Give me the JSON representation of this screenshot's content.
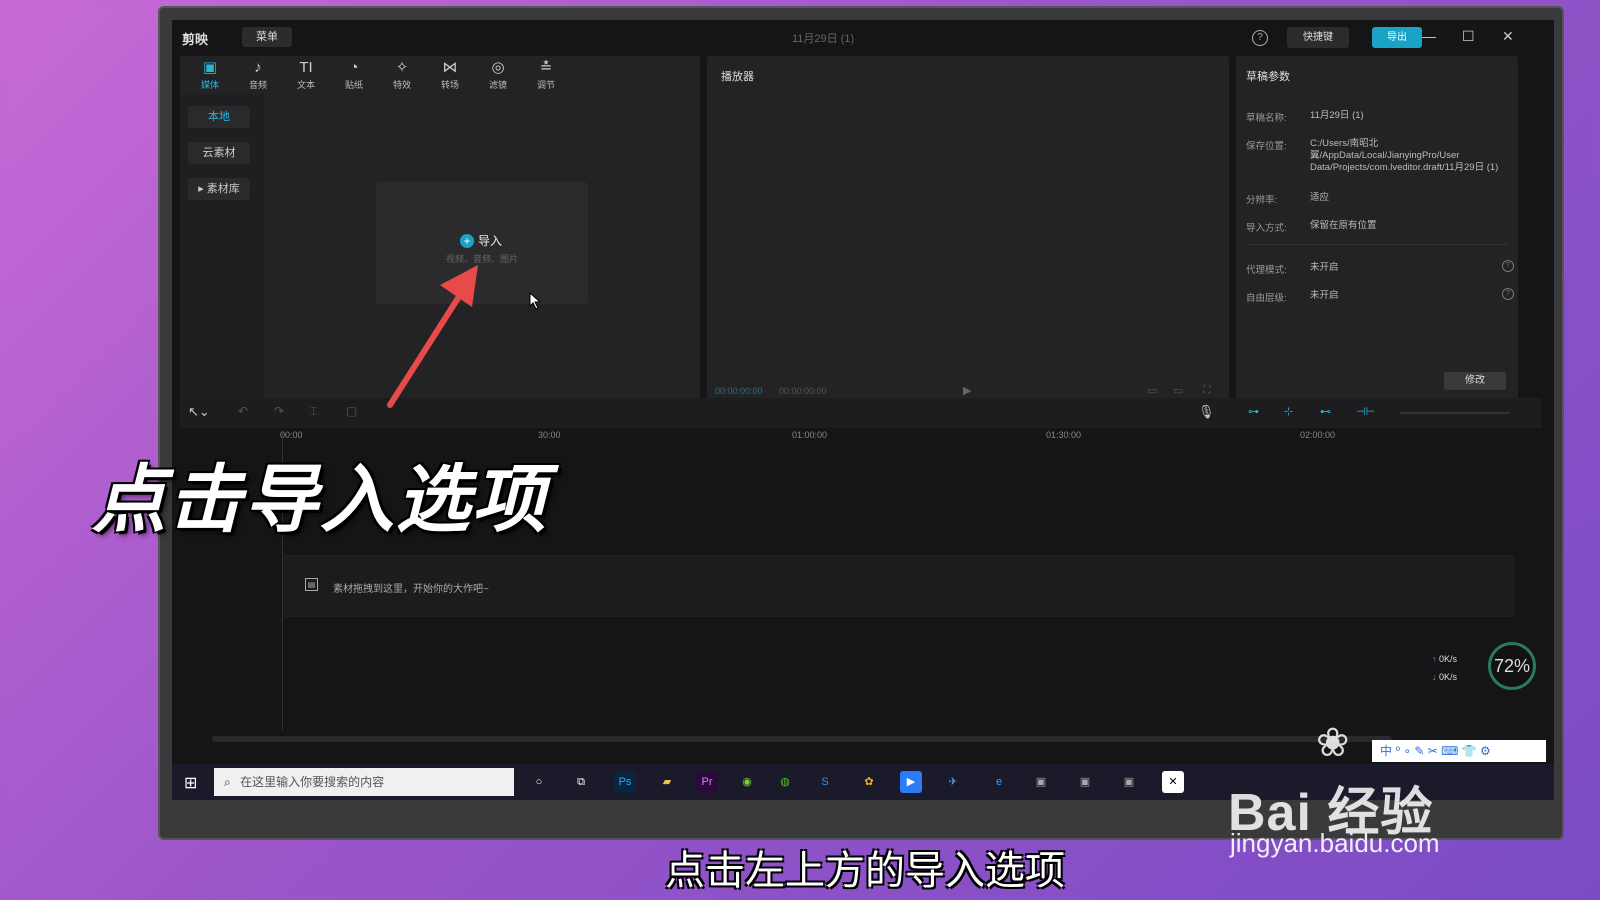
{
  "app": {
    "name": "剪映",
    "menu_label": "菜单",
    "document_title": "11月29日 (1)",
    "help_label": "?",
    "shortcut_label": "快捷键",
    "export_label": "导出",
    "minimize": "—",
    "maximize": "☐",
    "close": "✕"
  },
  "toolbar": {
    "items": [
      {
        "icon": "▣",
        "label": "媒体",
        "active": true
      },
      {
        "icon": "♪",
        "label": "音频"
      },
      {
        "icon": "TI",
        "label": "文本"
      },
      {
        "icon": "◔",
        "label": "贴纸"
      },
      {
        "icon": "✧",
        "label": "特效"
      },
      {
        "icon": "⋈",
        "label": "转场"
      },
      {
        "icon": "◎",
        "label": "滤镜"
      },
      {
        "icon": "≛",
        "label": "调节"
      }
    ]
  },
  "sidebar": {
    "items": [
      {
        "label": "本地",
        "active": true
      },
      {
        "label": "云素材"
      },
      {
        "label": "▸ 素材库"
      }
    ]
  },
  "media": {
    "import_label": "导入",
    "import_hint": "视频、音频、图片"
  },
  "player": {
    "title": "播放器",
    "time_current": "00:00:00:00",
    "time_total": "00:00:00:00",
    "play_icon": "▶"
  },
  "draft": {
    "title": "草稿参数",
    "props": [
      {
        "label": "草稿名称:",
        "value": "11月29日 (1)"
      },
      {
        "label": "保存位置:",
        "value": "C:/Users/南昭北翼/AppData/Local/JianyingPro/User Data/Projects/com.lveditor.draft/11月29日 (1)"
      },
      {
        "label": "分辨率:",
        "value": "适应"
      },
      {
        "label": "导入方式:",
        "value": "保留在原有位置"
      },
      {
        "label": "代理模式:",
        "value": "未开启"
      },
      {
        "label": "自由层级:",
        "value": "未开启"
      }
    ],
    "modify_label": "修改"
  },
  "timeline": {
    "ruler": [
      "00:00",
      "30:00",
      "01:00:00",
      "01:30:00",
      "02:00:00"
    ],
    "track_hint": "素材拖拽到这里，开始你的大作吧~"
  },
  "taskbar": {
    "search_placeholder": "在这里输入你要搜索的内容",
    "ime_label": "中 ⁰ ∘ ✎ ✂ ⌨ 👕 ⚙"
  },
  "monitor_widget": {
    "up_speed": "0K/s",
    "down_speed": "0K/s",
    "cpu_percent": "72%"
  },
  "overlay": {
    "headline": "点击导入选项",
    "caption": "点击左上方的导入选项",
    "watermark": "Bai 经验",
    "watermark_url": "jingyan.baidu.com"
  }
}
